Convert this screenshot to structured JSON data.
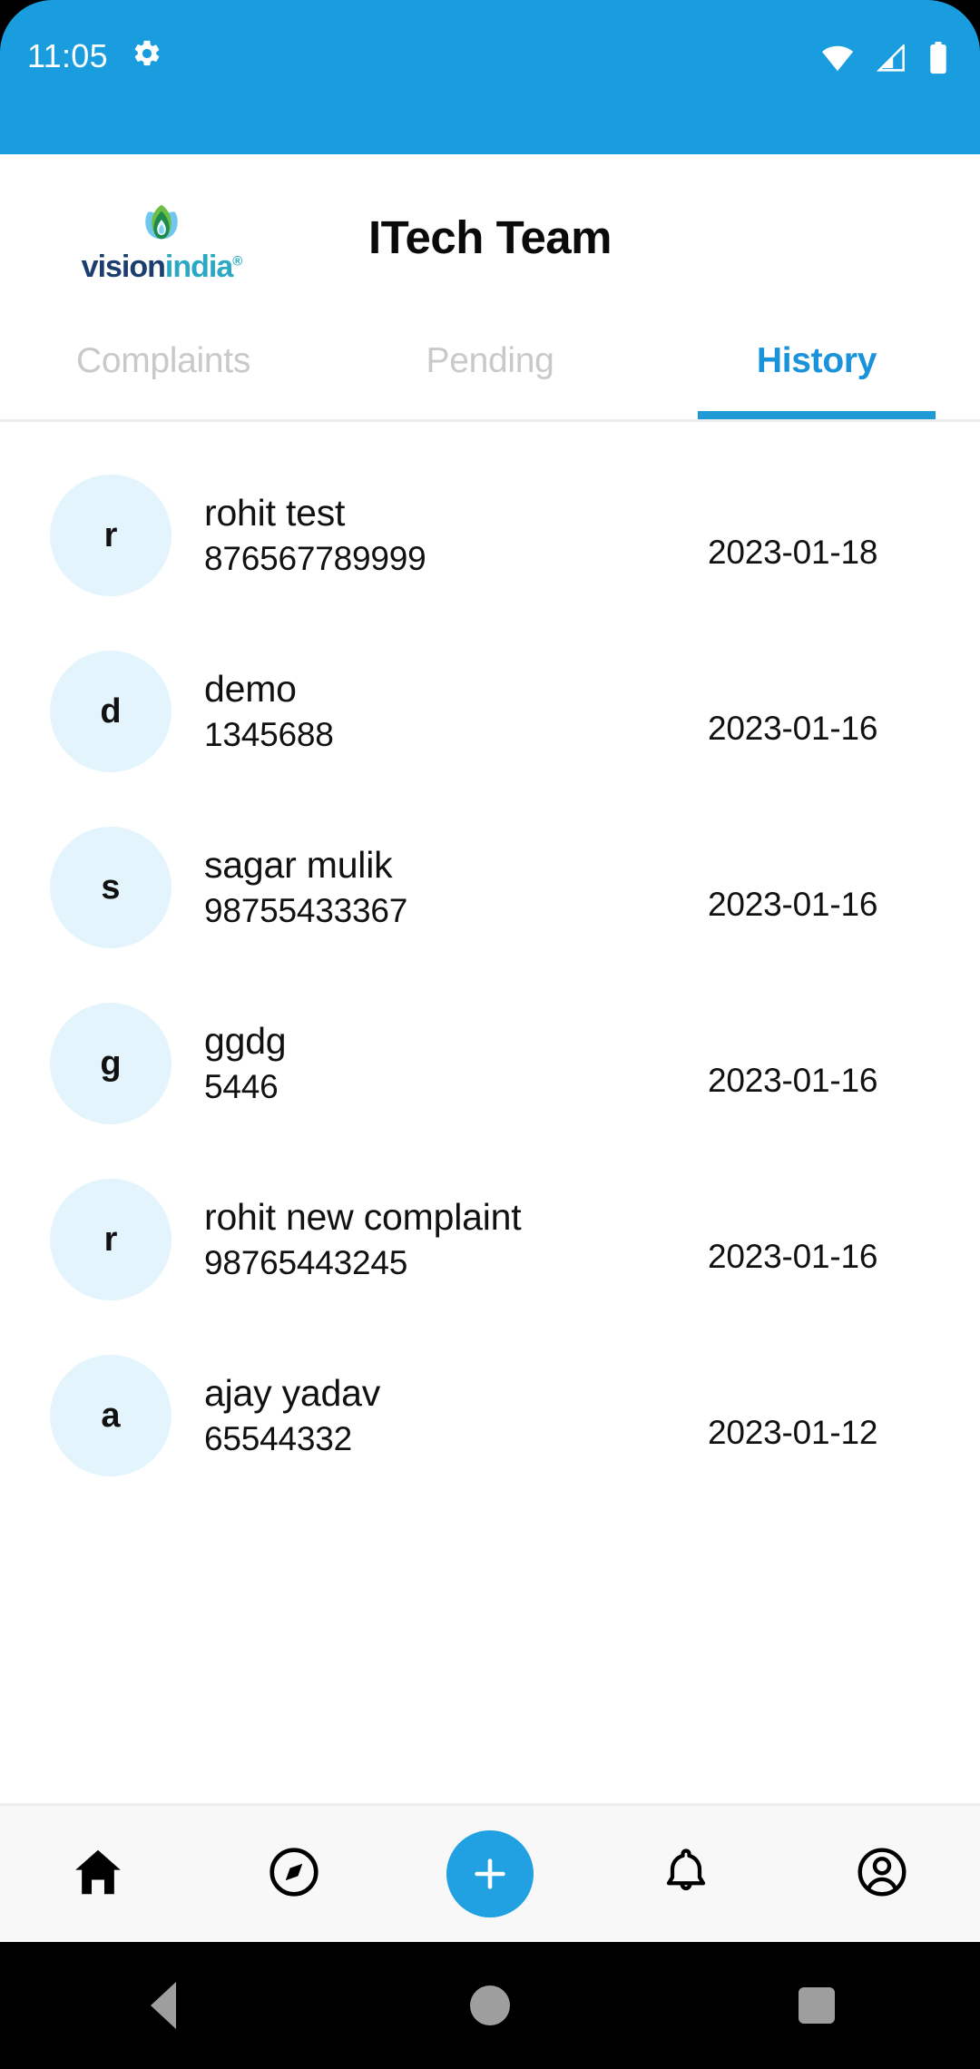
{
  "status_bar": {
    "time": "11:05",
    "icons": [
      "gear-icon",
      "wifi-icon",
      "cellular-signal-icon",
      "battery-icon"
    ],
    "background_color": "#1A9DDE"
  },
  "header": {
    "logo": {
      "text_primary": "vision",
      "text_secondary": "india",
      "registered_mark": "®",
      "primary_color": "#1B3E6F",
      "secondary_color": "#2AA8C4",
      "mark": "leaf-droplet-logo"
    },
    "title": "ITech Team"
  },
  "tabs": {
    "active_index": 2,
    "active_color": "#1A93DB",
    "inactive_color": "#c9c9c9",
    "items": [
      {
        "label": "Complaints"
      },
      {
        "label": "Pending"
      },
      {
        "label": "History"
      }
    ]
  },
  "list": {
    "rows": [
      {
        "initial": "r",
        "name": "rohit test",
        "phone": "876567789999",
        "date": "2023-01-18"
      },
      {
        "initial": "d",
        "name": "demo",
        "phone": "1345688",
        "date": "2023-01-16"
      },
      {
        "initial": "s",
        "name": "sagar mulik",
        "phone": "98755433367",
        "date": "2023-01-16"
      },
      {
        "initial": "g",
        "name": "ggdg",
        "phone": "5446",
        "date": "2023-01-16"
      },
      {
        "initial": "r",
        "name": "rohit new complaint",
        "phone": "98765443245",
        "date": "2023-01-16"
      },
      {
        "initial": "a",
        "name": "ajay yadav",
        "phone": "65544332",
        "date": "2023-01-12"
      }
    ],
    "avatar_background": "#E4F4FC"
  },
  "bottom_nav": {
    "accent_color": "#21A1E1",
    "items": [
      {
        "icon": "home-icon",
        "active": true
      },
      {
        "icon": "compass-icon",
        "active": false
      },
      {
        "icon": "add-plus-icon",
        "active": false
      },
      {
        "icon": "bell-icon",
        "active": false
      },
      {
        "icon": "profile-icon",
        "active": false
      }
    ]
  },
  "android_nav": {
    "items": [
      {
        "icon": "back-triangle-icon"
      },
      {
        "icon": "home-circle-icon"
      },
      {
        "icon": "recents-square-icon"
      }
    ]
  }
}
